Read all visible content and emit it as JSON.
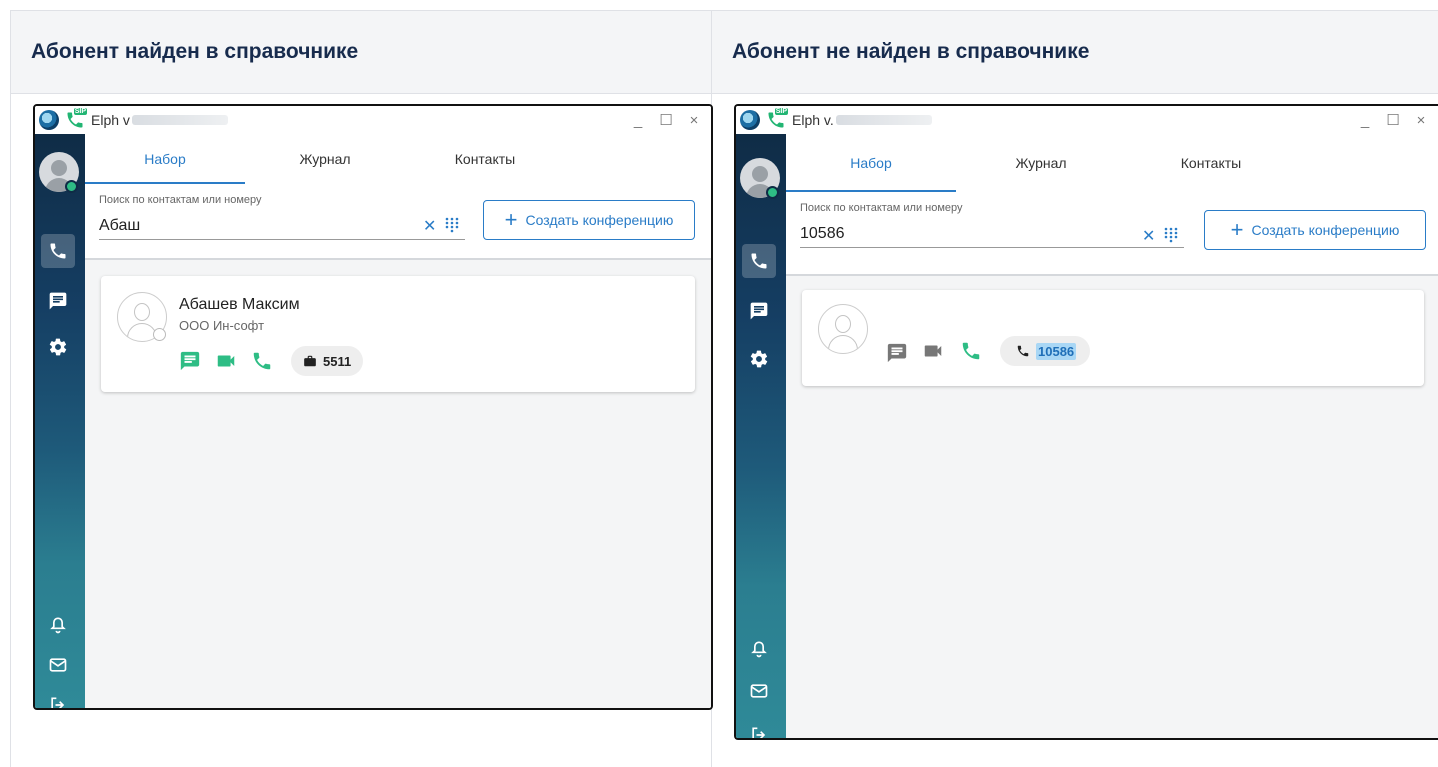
{
  "columns": [
    {
      "header": "Абонент найден в справочнике",
      "window": {
        "app_title": "Elph v",
        "tabs": [
          "Набор",
          "Журнал",
          "Контакты"
        ],
        "search": {
          "label": "Поиск по контактам или номеру",
          "value": "Абаш"
        },
        "conference_button": "Создать конференцию",
        "result": {
          "name": "Абашев Максим",
          "organization": "ООО Ин-софт",
          "actions_color": "#2ebd85",
          "number": "5511",
          "number_icon": "briefcase-icon"
        }
      }
    },
    {
      "header": "Абонент не найден в справочнике",
      "window": {
        "app_title": "Elph v.",
        "tabs": [
          "Набор",
          "Журнал",
          "Контакты"
        ],
        "search": {
          "label": "Поиск по контактам или номеру",
          "value": "10586"
        },
        "conference_button": "Создать конференцию",
        "result": {
          "actions_color": "#777777",
          "number": "10586",
          "number_icon": "phone-icon"
        }
      }
    }
  ],
  "window_controls": [
    "_",
    "☐",
    "×"
  ],
  "sip_badge": "SIP",
  "colors": {
    "accent": "#2a7cc7",
    "green": "#2ebd85",
    "sidebar": "#0f2c46"
  }
}
